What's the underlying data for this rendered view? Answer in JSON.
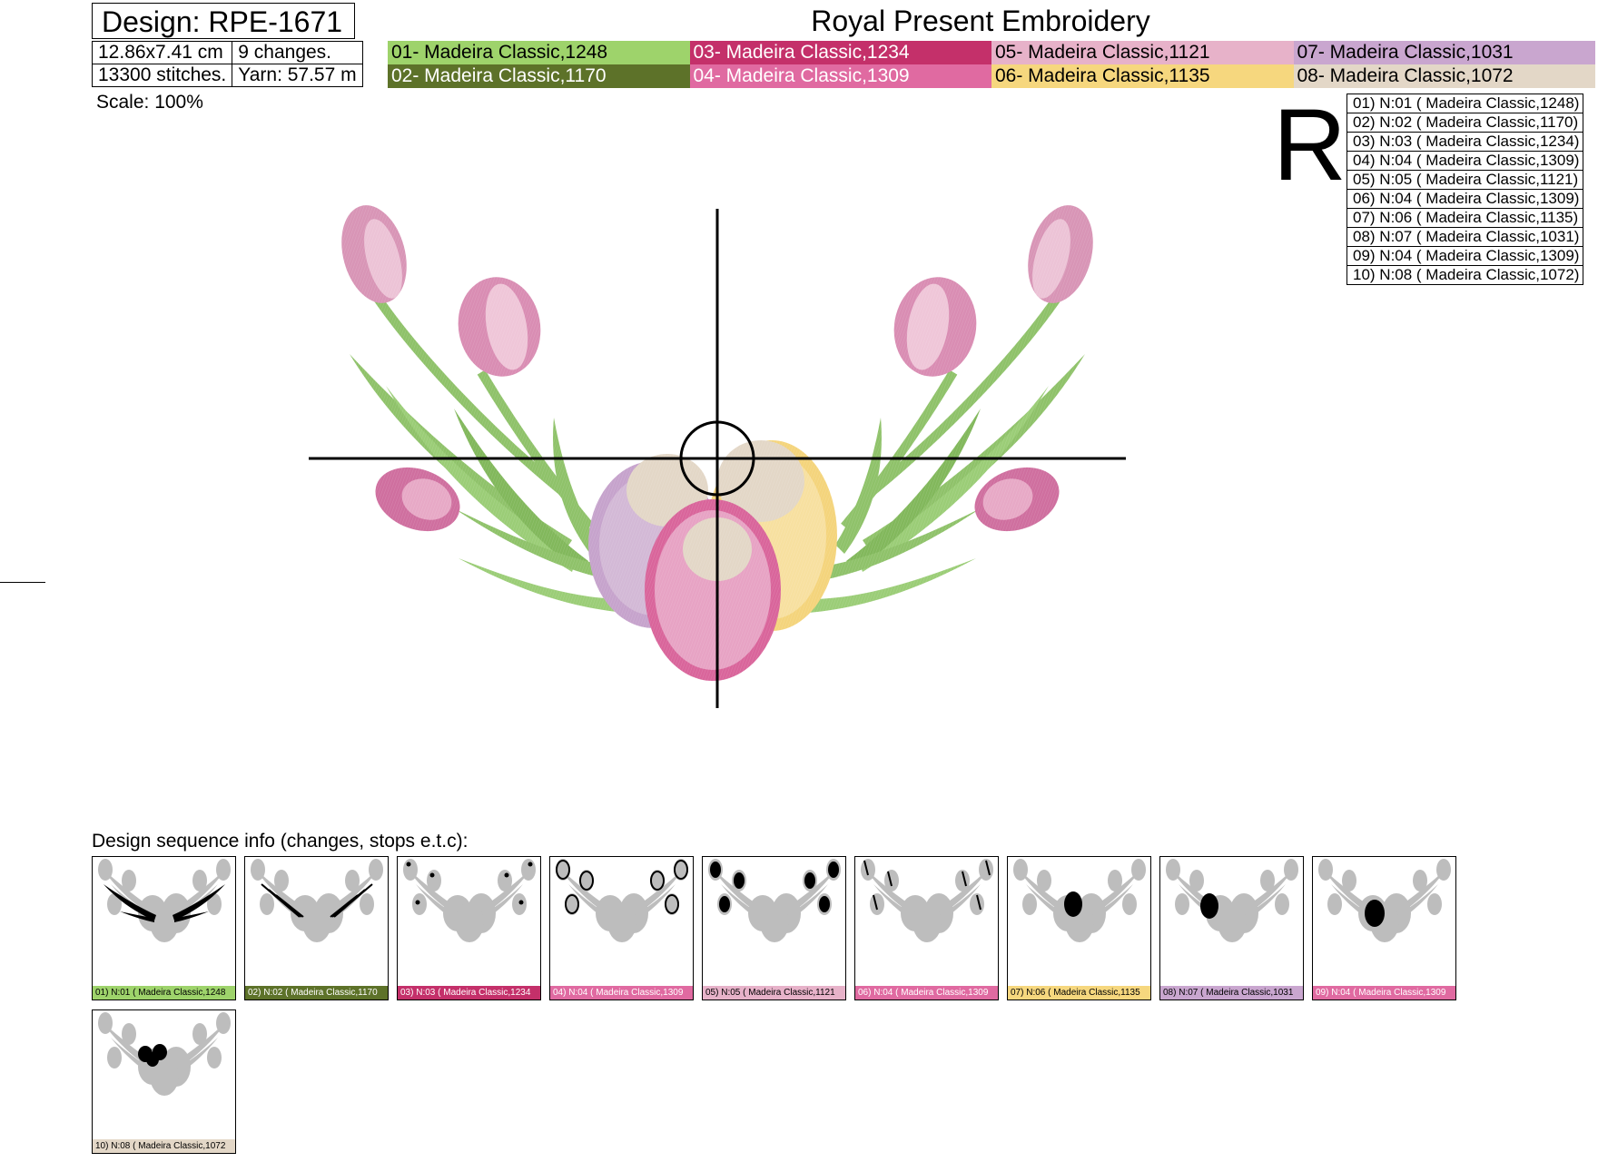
{
  "header": {
    "design_label": "Design: RPE-1671",
    "company": "Royal Present Embroidery",
    "size": "12.86x7.41 cm",
    "changes": "9 changes.",
    "stitches": "13300 stitches.",
    "yarn": "Yarn: 57.57 m"
  },
  "palette": [
    {
      "label": "01- Madeira Classic,1248",
      "color": "#9ed36b",
      "text": "light"
    },
    {
      "label": "03- Madeira Classic,1234",
      "color": "#c4306a",
      "text": "dark"
    },
    {
      "label": "05- Madeira Classic,1121",
      "color": "#e7b2c9",
      "text": "light"
    },
    {
      "label": "07- Madeira Classic,1031",
      "color": "#c9a6cf",
      "text": "light"
    },
    {
      "label": "02- Madeira Classic,1170",
      "color": "#5d7229",
      "text": "dark"
    },
    {
      "label": "04- Madeira Classic,1309",
      "color": "#e06aa1",
      "text": "dark"
    },
    {
      "label": "06- Madeira Classic,1135",
      "color": "#f6d77e",
      "text": "light"
    },
    {
      "label": "08- Madeira Classic,1072",
      "color": "#e3d7c7",
      "text": "light"
    }
  ],
  "scale_label": "Scale: 100%",
  "orientation_letter": "R",
  "sequence": [
    "01) N:01 ( Madeira Classic,1248)",
    "02) N:02 ( Madeira Classic,1170)",
    "03) N:03 ( Madeira Classic,1234)",
    "04) N:04 ( Madeira Classic,1309)",
    "05) N:05 ( Madeira Classic,1121)",
    "06) N:04 ( Madeira Classic,1309)",
    "07) N:06 ( Madeira Classic,1135)",
    "08) N:07 ( Madeira Classic,1031)",
    "09) N:04 ( Madeira Classic,1309)",
    "10) N:08 ( Madeira Classic,1072)"
  ],
  "sequence_title": "Design sequence info (changes, stops e.t.c):",
  "thumbnails": [
    {
      "label": "01) N:01 ( Madeira Classic,1248",
      "color": "#9ed36b",
      "text": "light",
      "highlight": "leaves"
    },
    {
      "label": "02) N:02 ( Madeira Classic,1170",
      "color": "#5d7229",
      "text": "dark",
      "highlight": "leaf-veins"
    },
    {
      "label": "03) N:03 ( Madeira Classic,1234",
      "color": "#c4306a",
      "text": "dark",
      "highlight": "bud-tips"
    },
    {
      "label": "04) N:04 ( Madeira Classic,1309",
      "color": "#e06aa1",
      "text": "dark",
      "highlight": "bud-outlines"
    },
    {
      "label": "05) N:05 ( Madeira Classic,1121",
      "color": "#e7b2c9",
      "text": "light",
      "highlight": "bud-fills"
    },
    {
      "label": "06) N:04 ( Madeira Classic,1309",
      "color": "#e06aa1",
      "text": "dark",
      "highlight": "bud-strokes"
    },
    {
      "label": "07) N:06 ( Madeira Classic,1135",
      "color": "#f6d77e",
      "text": "light",
      "highlight": "egg-right"
    },
    {
      "label": "08) N:07 ( Madeira Classic,1031",
      "color": "#c9a6cf",
      "text": "light",
      "highlight": "egg-left"
    },
    {
      "label": "09) N:04 ( Madeira Classic,1309",
      "color": "#e06aa1",
      "text": "dark",
      "highlight": "egg-center"
    },
    {
      "label": "10) N:08 ( Madeira Classic,1072",
      "color": "#e3d7c7",
      "text": "light",
      "highlight": "egg-spots"
    }
  ]
}
